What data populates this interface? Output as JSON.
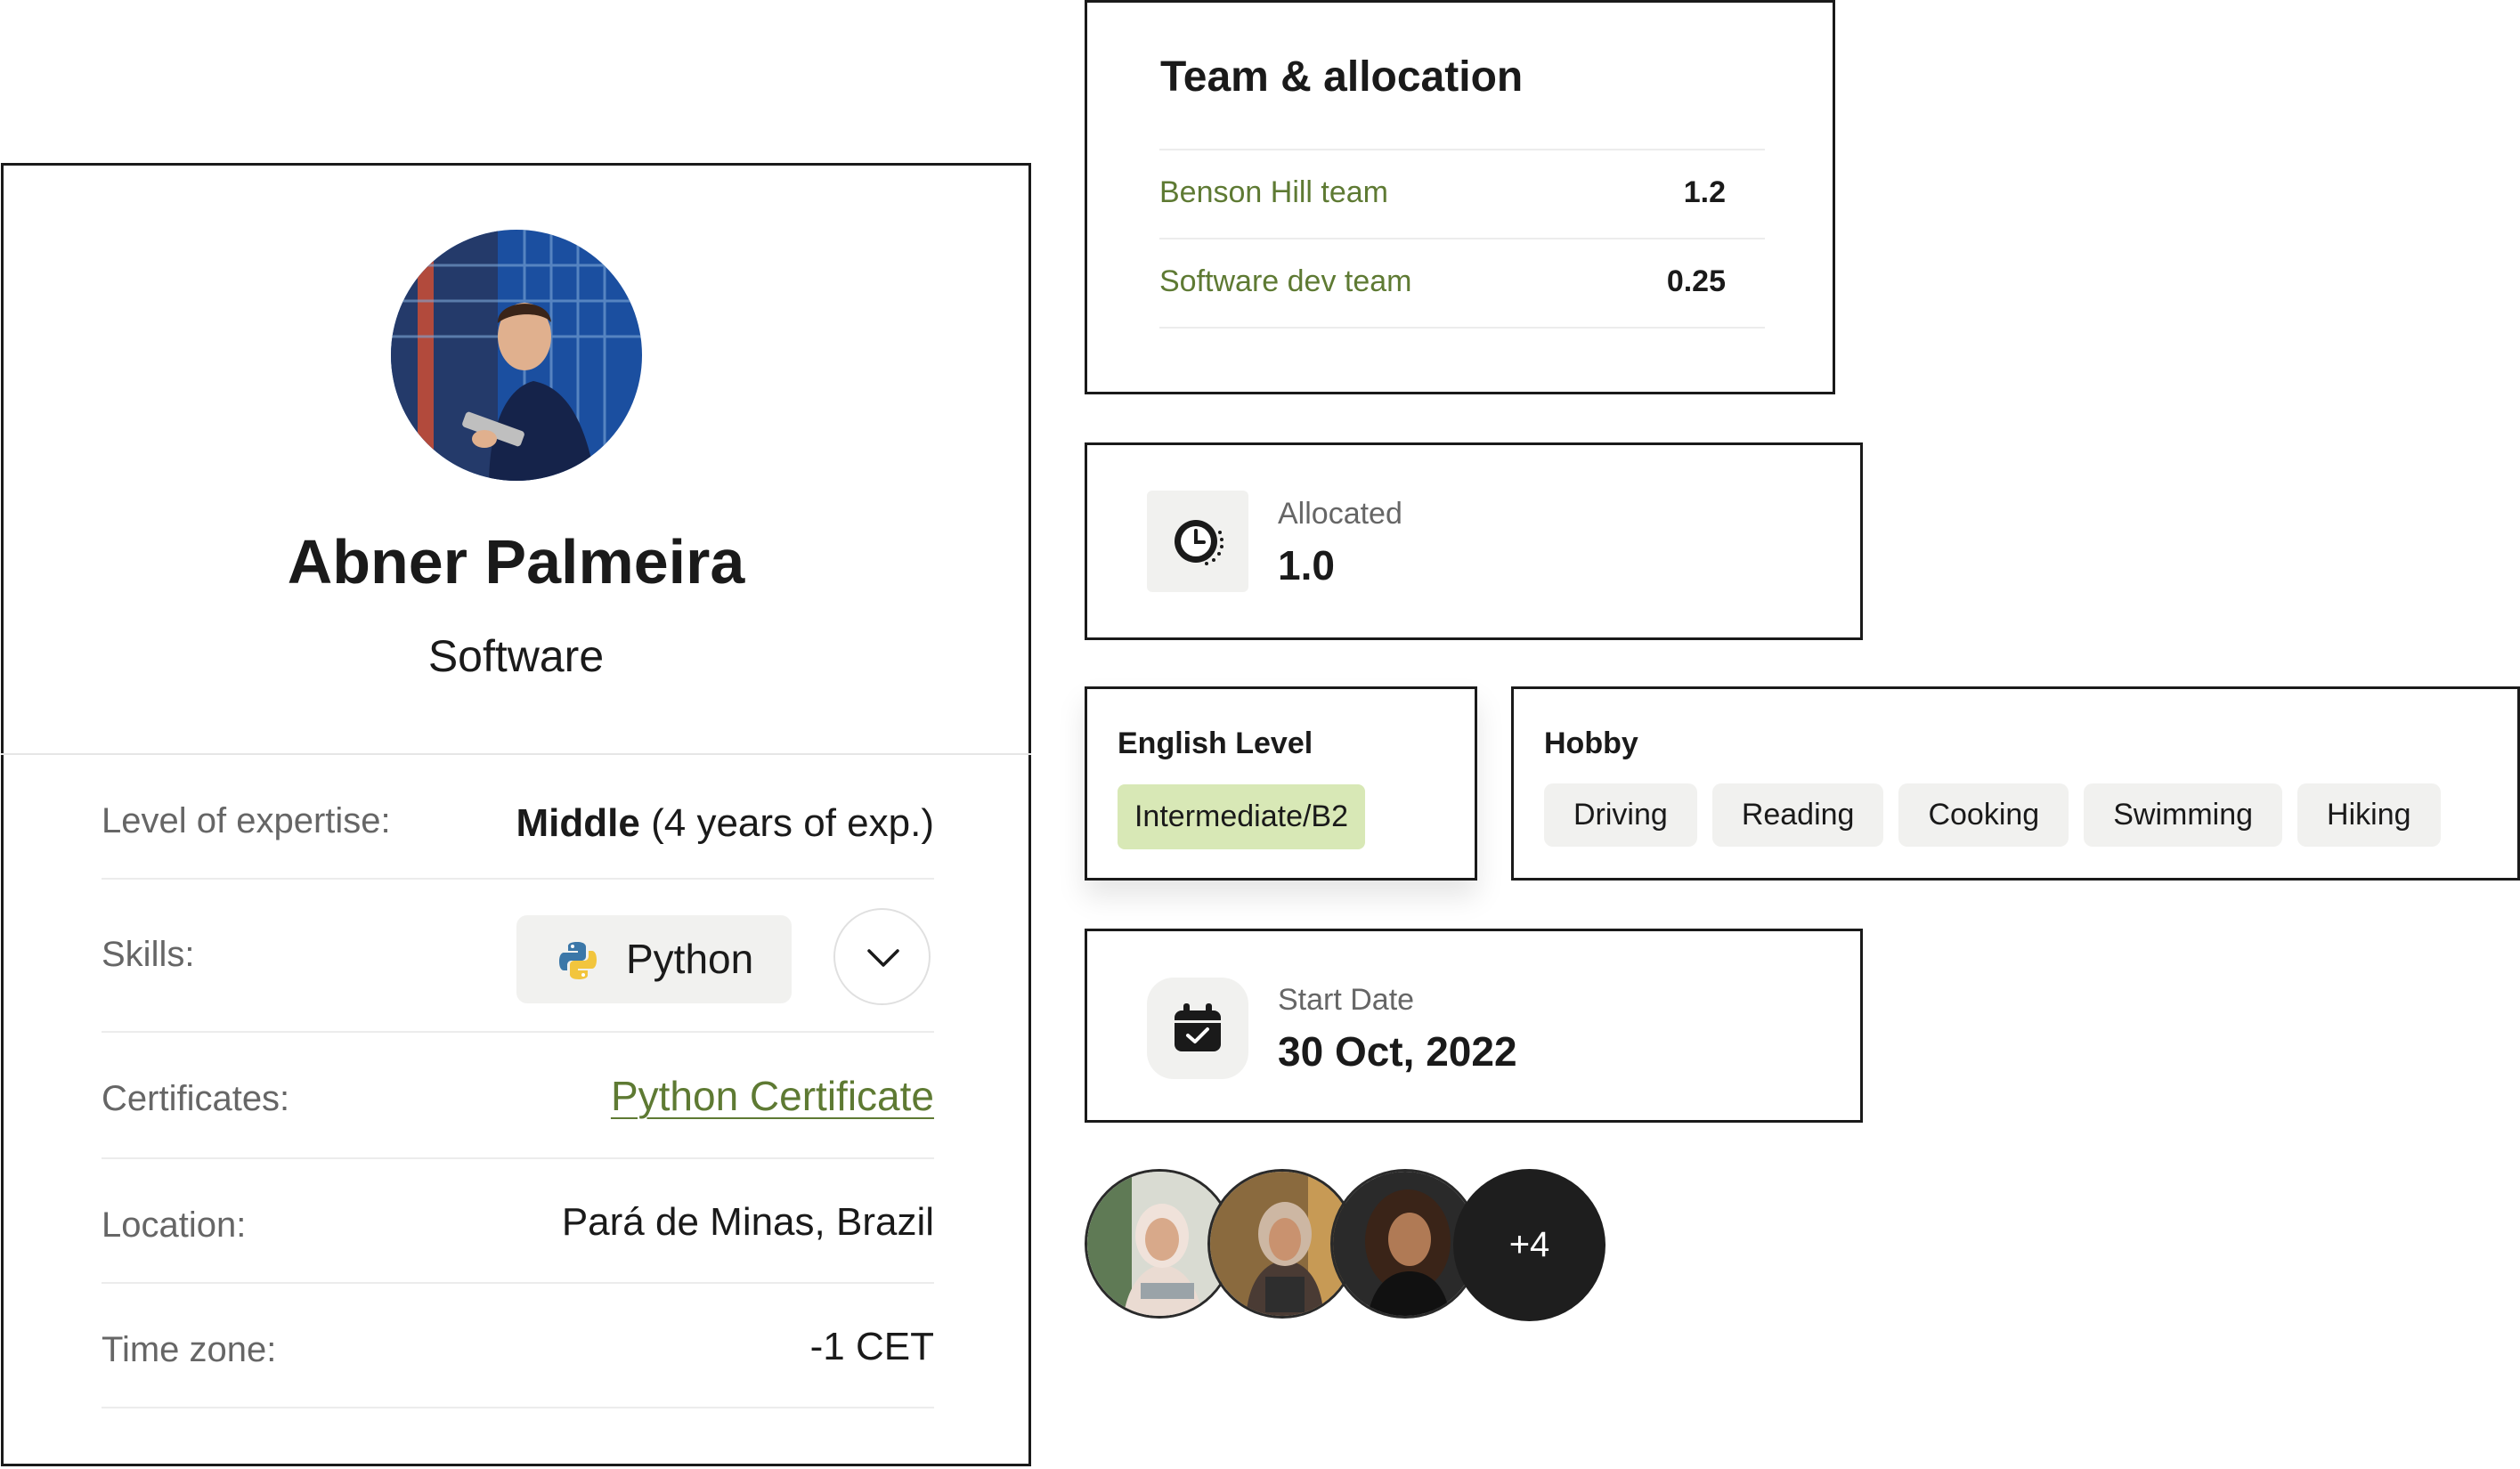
{
  "profile": {
    "name": "Abner Palmeira",
    "role": "Software",
    "fields": {
      "expertise_label": "Level of expertise:",
      "expertise_level": "Middle",
      "expertise_years": "(4 years of exp.)",
      "skills_label": "Skills:",
      "skill": "Python",
      "certificates_label": "Certificates:",
      "certificate": "Python Certificate",
      "location_label": "Location:",
      "location": "Pará de Minas, Brazil",
      "timezone_label": "Time zone:",
      "timezone": "-1 CET"
    }
  },
  "team": {
    "title": "Team & allocation",
    "rows": [
      {
        "name": "Benson Hill team",
        "value": "1.2"
      },
      {
        "name": "Software dev team",
        "value": "0.25"
      }
    ]
  },
  "allocated": {
    "label": "Allocated",
    "value": "1.0",
    "icon": "clock-icon"
  },
  "english": {
    "title": "English Level",
    "level": "Intermediate/B2"
  },
  "hobby": {
    "title": "Hobby",
    "items": [
      "Driving",
      "Reading",
      "Cooking",
      "Swimming",
      "Hiking"
    ]
  },
  "start_date": {
    "label": "Start Date",
    "value": "30 Oct, 2022",
    "icon": "calendar-check-icon"
  },
  "team_members": {
    "more": "+4"
  },
  "colors": {
    "accent_text": "#5e7a33",
    "level_chip": "#d8e8b6",
    "chip_bg": "#f1f1ef",
    "border": "#1a1a1a"
  }
}
